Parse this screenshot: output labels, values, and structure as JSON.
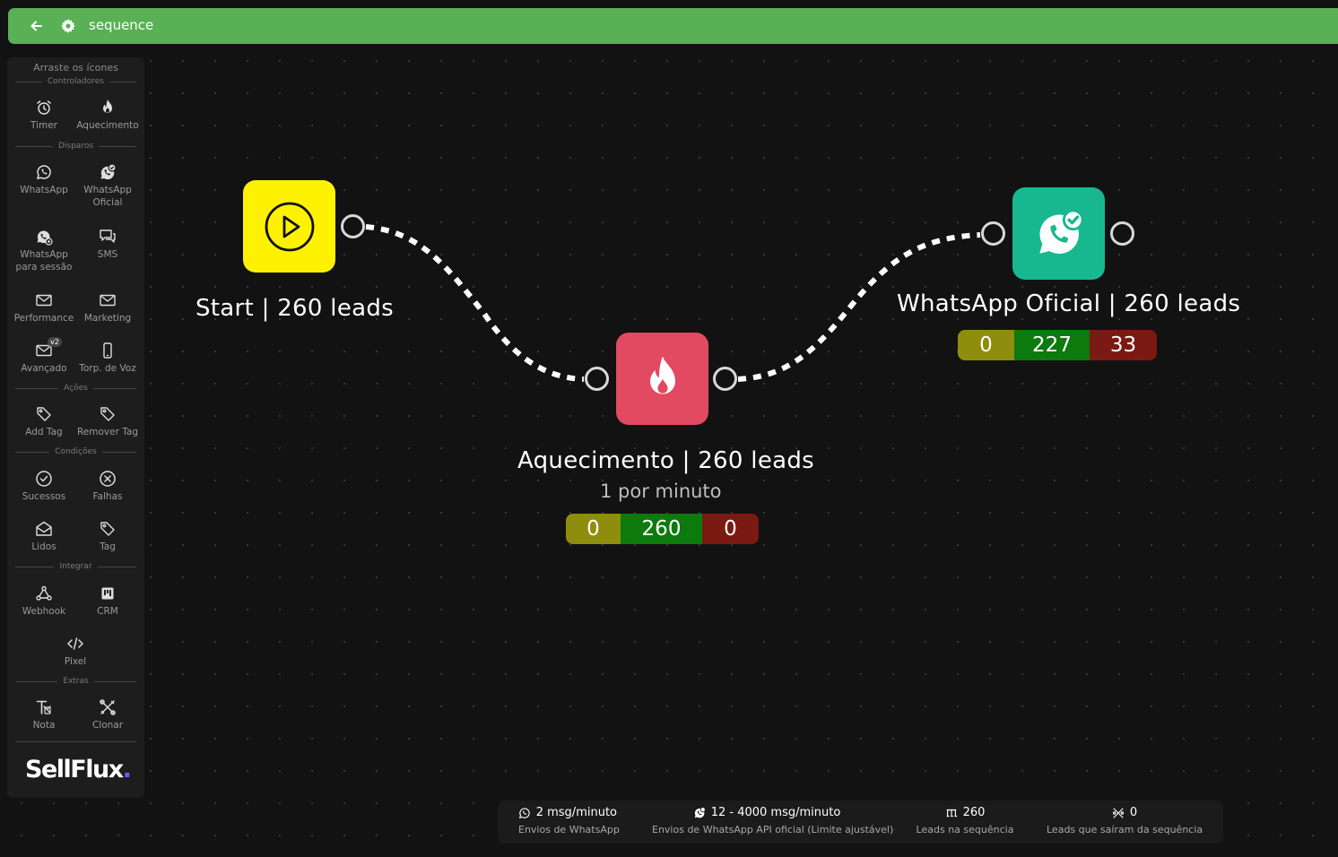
{
  "header": {
    "title": "sequence"
  },
  "sidebar": {
    "heading": "Arraste os ícones",
    "sections": {
      "controladores": "Controladores",
      "disparos": "Disparos",
      "acoes": "Ações",
      "condicoes": "Condições",
      "integrar": "Integrar",
      "extras": "Extras"
    },
    "items": {
      "timer": "Timer",
      "aquecimento": "Aquecimento",
      "whatsapp": "WhatsApp",
      "whatsapp_oficial_1": "WhatsApp",
      "whatsapp_oficial_2": "Oficial",
      "whatsapp_sessao_1": "WhatsApp",
      "whatsapp_sessao_2": "para sessão",
      "sms": "SMS",
      "performance": "Performance",
      "marketing": "Marketing",
      "avancado": "Avançado",
      "avancado_badge": "v2",
      "torpedo": "Torp. de Voz",
      "add_tag": "Add Tag",
      "remover_tag": "Remover Tag",
      "sucessos": "Sucessos",
      "falhas": "Falhas",
      "lidos": "Lidos",
      "tag": "Tag",
      "webhook": "Webhook",
      "crm": "CRM",
      "pixel": "Pixel",
      "nota": "Nota",
      "clonar": "Clonar"
    },
    "logo": {
      "text": "SellFlux",
      "dot": "."
    }
  },
  "nodes": {
    "start": {
      "label": "Start | 260 leads",
      "icon": "play-icon",
      "color": "#fff200"
    },
    "aquecimento": {
      "label": "Aquecimento | 260 leads",
      "sublabel": "1 por minuto",
      "icon": "flame-icon",
      "color": "#e24a62",
      "stats": {
        "pending": "0",
        "success": "260",
        "failed": "0"
      }
    },
    "whatsapp_oficial": {
      "label": "WhatsApp Oficial | 260 leads",
      "icon": "whatsapp-verified-icon",
      "color": "#17b890",
      "stats": {
        "pending": "0",
        "success": "227",
        "failed": "33"
      }
    }
  },
  "footer": {
    "whatsapp_rate": {
      "value": "2 msg/minuto",
      "desc": "Envios de WhatsApp"
    },
    "api_rate": {
      "value": "12 - 4000 msg/minuto",
      "desc": "Envios de WhatsApp API oficial (Limite ajustável)"
    },
    "leads_in": {
      "value": "260",
      "desc": "Leads na sequência"
    },
    "leads_out": {
      "value": "0",
      "desc": "Leads que saíram da sequência"
    }
  },
  "colors": {
    "topbar": "#5ab055",
    "pending": "#8f8d0e",
    "success": "#0d7a0d",
    "failed": "#7a1a12"
  }
}
